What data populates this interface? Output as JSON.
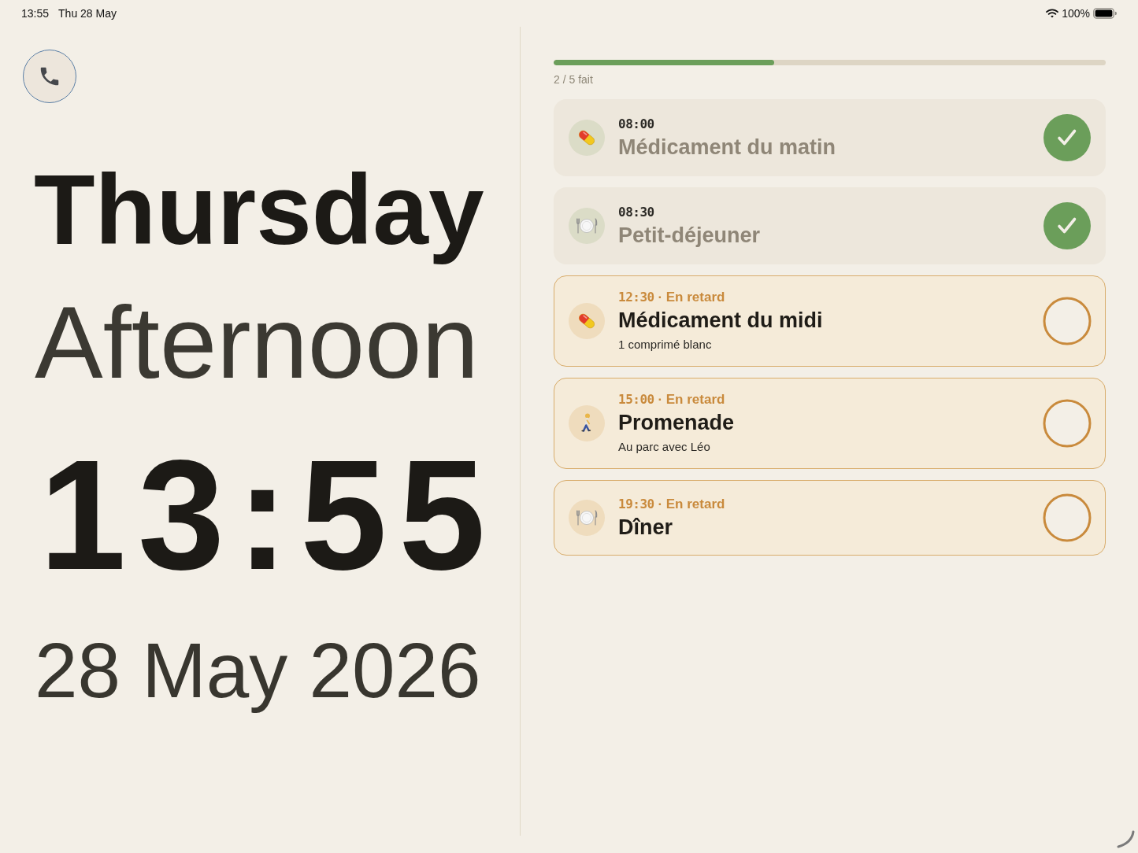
{
  "status_bar": {
    "time": "13:55",
    "date": "Thu 28 May",
    "battery": "100%"
  },
  "clock": {
    "weekday": "Thursday",
    "period": "Afternoon",
    "time": "13:55",
    "date": "28 May 2026"
  },
  "progress": {
    "level": 0.4,
    "label": "2 / 5 fait"
  },
  "tasks": [
    {
      "kind": "pill",
      "time": "08:00",
      "title": "Médicament du matin",
      "done": true,
      "late": false
    },
    {
      "kind": "plate",
      "time": "08:30",
      "title": "Petit-déjeuner",
      "done": true,
      "late": false
    },
    {
      "kind": "pill",
      "time": "12:30",
      "separator": "·",
      "status": "En retard",
      "title": "Médicament du midi",
      "note": "1 comprimé blanc",
      "done": false,
      "late": true
    },
    {
      "kind": "walker",
      "time": "15:00",
      "separator": "·",
      "status": "En retard",
      "title": "Promenade",
      "note": "Au parc avec Léo",
      "done": false,
      "late": true
    },
    {
      "kind": "plate",
      "time": "19:30",
      "separator": "·",
      "status": "En retard",
      "title": "Dîner",
      "done": false,
      "late": true
    }
  ]
}
